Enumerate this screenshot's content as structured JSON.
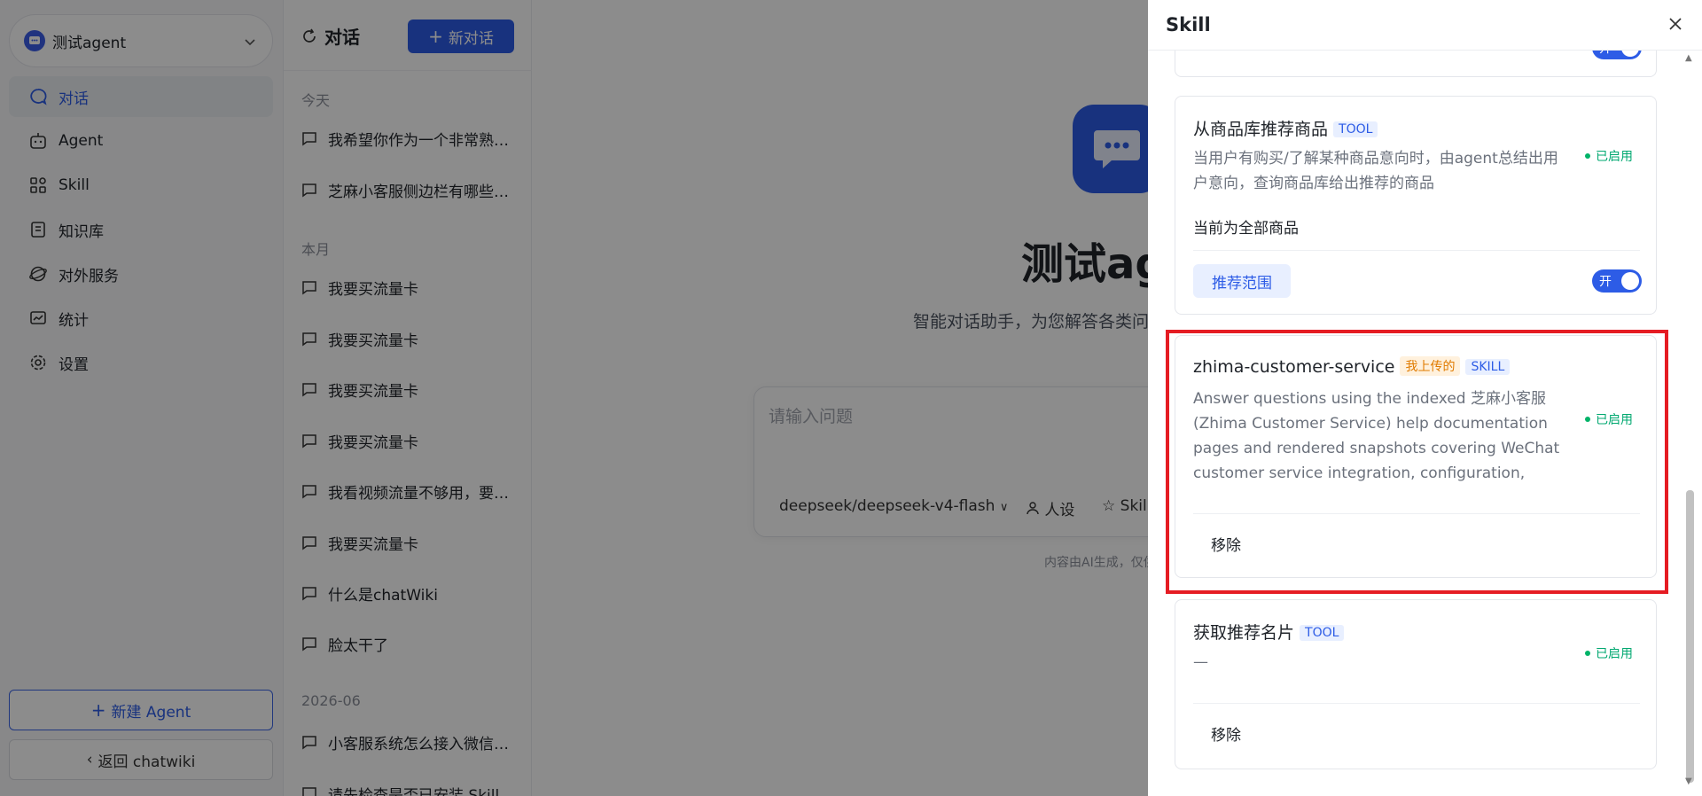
{
  "nav": {
    "agent_name": "测试agent",
    "items": [
      {
        "label": "对话",
        "icon": "chat-bubble-icon",
        "active": true
      },
      {
        "label": "Agent",
        "icon": "robot-icon"
      },
      {
        "label": "Skill",
        "icon": "grid-icon"
      },
      {
        "label": "知识库",
        "icon": "book-icon"
      },
      {
        "label": "对外服务",
        "icon": "globe-icon"
      },
      {
        "label": "统计",
        "icon": "chart-icon"
      },
      {
        "label": "设置",
        "icon": "gear-icon"
      }
    ],
    "new_agent": "新建 Agent",
    "back": "返回 chatwiki"
  },
  "conversations": {
    "title": "对话",
    "new_button": "新对话",
    "groups": [
      {
        "label": "今天",
        "items": [
          "我希望你作为一个非常熟悉中国移动业务的客服",
          "芝麻小客服侧边栏有哪些功能"
        ]
      },
      {
        "label": "本月",
        "items": [
          "我要买流量卡",
          "我要买流量卡",
          "我要买流量卡",
          "我要买流量卡",
          "我看视频流量不够用，要买什么",
          "我要买流量卡",
          "什么是chatWiki",
          "脸太干了"
        ]
      },
      {
        "label": "2026-06",
        "items": [
          "小客服系统怎么接入微信公众号",
          "请先检查是否已安装 Skill"
        ]
      }
    ]
  },
  "main": {
    "title": "测试agent",
    "subtitle": "智能对话助手，为您解答各类问题",
    "input_placeholder": "请输入问题",
    "model": "deepseek/deepseek-v4-flash",
    "persona": "人设",
    "skill": "Skill",
    "disclaimer": "内容由AI生成，仅供参考"
  },
  "drawer": {
    "title": "Skill",
    "cards": [
      {
        "name": "从商品库推荐商品",
        "tags": [
          "TOOL"
        ],
        "desc": "当用户有购买/了解某种商品意向时，由agent总结出用户意向，查询商品库给出推荐的商品",
        "status": "已启用",
        "scope": "当前为全部商品",
        "range_button": "推荐范围",
        "toggle": "开"
      },
      {
        "name": "zhima-customer-service",
        "tags": [
          "我上传的",
          "SKILL"
        ],
        "desc": "Answer questions using the indexed 芝麻小客服 (Zhima Customer Service) help documentation pages and rendered snapshots covering WeChat customer service integration, configuration, API…",
        "status": "已启用",
        "remove": "移除"
      },
      {
        "name": "获取推荐名片",
        "tags": [
          "TOOL"
        ],
        "desc": "—",
        "status": "已启用",
        "remove": "移除"
      }
    ],
    "top_toggle": "开"
  },
  "colors": {
    "accent": "#2d5ce6",
    "status_green": "#00a870",
    "highlight": "#e51c23"
  }
}
